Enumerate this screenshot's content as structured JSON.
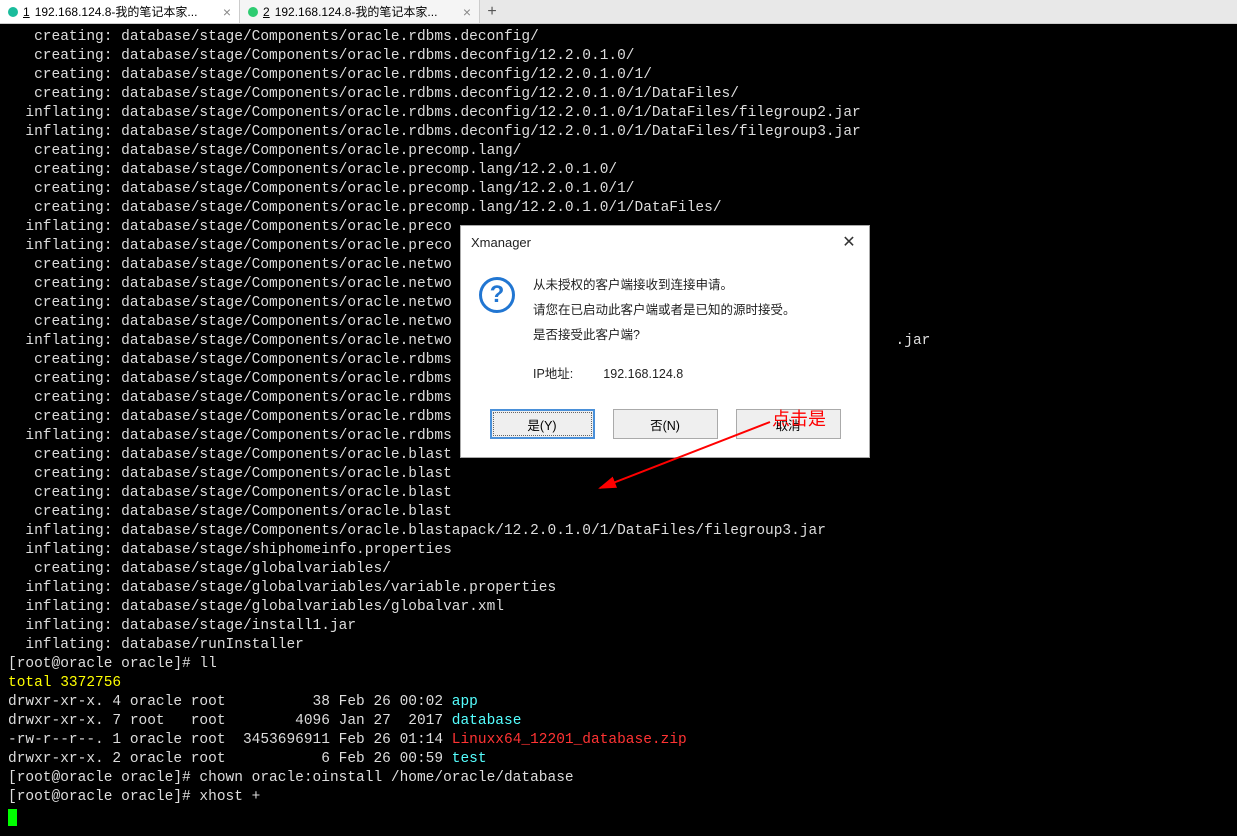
{
  "tabs": [
    {
      "num": "1",
      "title": "192.168.124.8-我的笔记本家...",
      "dot": "teal",
      "active": true
    },
    {
      "num": "2",
      "title": "192.168.124.8-我的笔记本家...",
      "dot": "green",
      "active": false
    }
  ],
  "terminal": {
    "lines": [
      {
        "t": "   creating: database/stage/Components/oracle.rdbms.deconfig/",
        "c": "c-white"
      },
      {
        "t": "   creating: database/stage/Components/oracle.rdbms.deconfig/12.2.0.1.0/",
        "c": "c-white"
      },
      {
        "t": "   creating: database/stage/Components/oracle.rdbms.deconfig/12.2.0.1.0/1/",
        "c": "c-white"
      },
      {
        "t": "   creating: database/stage/Components/oracle.rdbms.deconfig/12.2.0.1.0/1/DataFiles/",
        "c": "c-white"
      },
      {
        "t": "  inflating: database/stage/Components/oracle.rdbms.deconfig/12.2.0.1.0/1/DataFiles/filegroup2.jar",
        "c": "c-white"
      },
      {
        "t": "  inflating: database/stage/Components/oracle.rdbms.deconfig/12.2.0.1.0/1/DataFiles/filegroup3.jar",
        "c": "c-white"
      },
      {
        "t": "   creating: database/stage/Components/oracle.precomp.lang/",
        "c": "c-white"
      },
      {
        "t": "   creating: database/stage/Components/oracle.precomp.lang/12.2.0.1.0/",
        "c": "c-white"
      },
      {
        "t": "   creating: database/stage/Components/oracle.precomp.lang/12.2.0.1.0/1/",
        "c": "c-white"
      },
      {
        "t": "   creating: database/stage/Components/oracle.precomp.lang/12.2.0.1.0/1/DataFiles/",
        "c": "c-white"
      },
      {
        "t": "  inflating: database/stage/Components/oracle.preco",
        "c": "c-white",
        "cut": true
      },
      {
        "t": "  inflating: database/stage/Components/oracle.preco",
        "c": "c-white",
        "cut": true
      },
      {
        "t": "   creating: database/stage/Components/oracle.netwo",
        "c": "c-white",
        "cut": true
      },
      {
        "t": "   creating: database/stage/Components/oracle.netwo",
        "c": "c-white",
        "cut": true
      },
      {
        "t": "   creating: database/stage/Components/oracle.netwo",
        "c": "c-white",
        "cut": true
      },
      {
        "t": "   creating: database/stage/Components/oracle.netwo",
        "c": "c-white",
        "cut": true
      },
      {
        "t": "  inflating: database/stage/Components/oracle.netwo",
        "c": "c-white",
        "cut": true,
        "tail": ".jar"
      },
      {
        "t": "   creating: database/stage/Components/oracle.rdbms",
        "c": "c-white",
        "cut": true
      },
      {
        "t": "   creating: database/stage/Components/oracle.rdbms",
        "c": "c-white",
        "cut": true
      },
      {
        "t": "   creating: database/stage/Components/oracle.rdbms",
        "c": "c-white",
        "cut": true
      },
      {
        "t": "   creating: database/stage/Components/oracle.rdbms",
        "c": "c-white",
        "cut": true
      },
      {
        "t": "  inflating: database/stage/Components/oracle.rdbms",
        "c": "c-white",
        "cut": true
      },
      {
        "t": "   creating: database/stage/Components/oracle.blast",
        "c": "c-white",
        "cut": true
      },
      {
        "t": "   creating: database/stage/Components/oracle.blast",
        "c": "c-white",
        "cut": true
      },
      {
        "t": "   creating: database/stage/Components/oracle.blast",
        "c": "c-white",
        "cut": true
      },
      {
        "t": "   creating: database/stage/Components/oracle.blast",
        "c": "c-white",
        "cut": true
      },
      {
        "t": "  inflating: database/stage/Components/oracle.blastapack/12.2.0.1.0/1/DataFiles/filegroup3.jar",
        "c": "c-white"
      },
      {
        "t": "  inflating: database/stage/shiphomeinfo.properties",
        "c": "c-white"
      },
      {
        "t": "   creating: database/stage/globalvariables/",
        "c": "c-white"
      },
      {
        "t": "  inflating: database/stage/globalvariables/variable.properties",
        "c": "c-white"
      },
      {
        "t": "  inflating: database/stage/globalvariables/globalvar.xml",
        "c": "c-white"
      },
      {
        "t": "  inflating: database/stage/install1.jar",
        "c": "c-white"
      },
      {
        "t": "  inflating: database/runInstaller",
        "c": "c-white"
      }
    ],
    "prompt1": "[root@oracle oracle]# ll",
    "total": "total 3372756",
    "ls": [
      {
        "perm": "drwxr-xr-x. 4 oracle root          38 Feb 26 00:02 ",
        "name": "app",
        "c": "c-cyan"
      },
      {
        "perm": "drwxr-xr-x. 7 root   root        4096 Jan 27  2017 ",
        "name": "database",
        "c": "c-cyan"
      },
      {
        "perm": "-rw-r--r--. 1 oracle root  3453696911 Feb 26 01:14 ",
        "name": "Linuxx64_12201_database.zip",
        "c": "c-red"
      },
      {
        "perm": "drwxr-xr-x. 2 oracle root           6 Feb 26 00:59 ",
        "name": "test",
        "c": "c-cyan"
      }
    ],
    "prompt2": "[root@oracle oracle]# chown oracle:oinstall /home/oracle/database",
    "prompt3": "[root@oracle oracle]# xhost +"
  },
  "dialog": {
    "title": "Xmanager",
    "line1": "从未授权的客户端接收到连接申请。",
    "line2": "请您在已启动此客户端或者是已知的源时接受。",
    "line3": "是否接受此客户端?",
    "ip_label": "IP地址:",
    "ip_value": "192.168.124.8",
    "btn_yes": "是(Y)",
    "btn_no": "否(N)",
    "btn_cancel": "取消"
  },
  "annotation": {
    "text": "点击是"
  }
}
